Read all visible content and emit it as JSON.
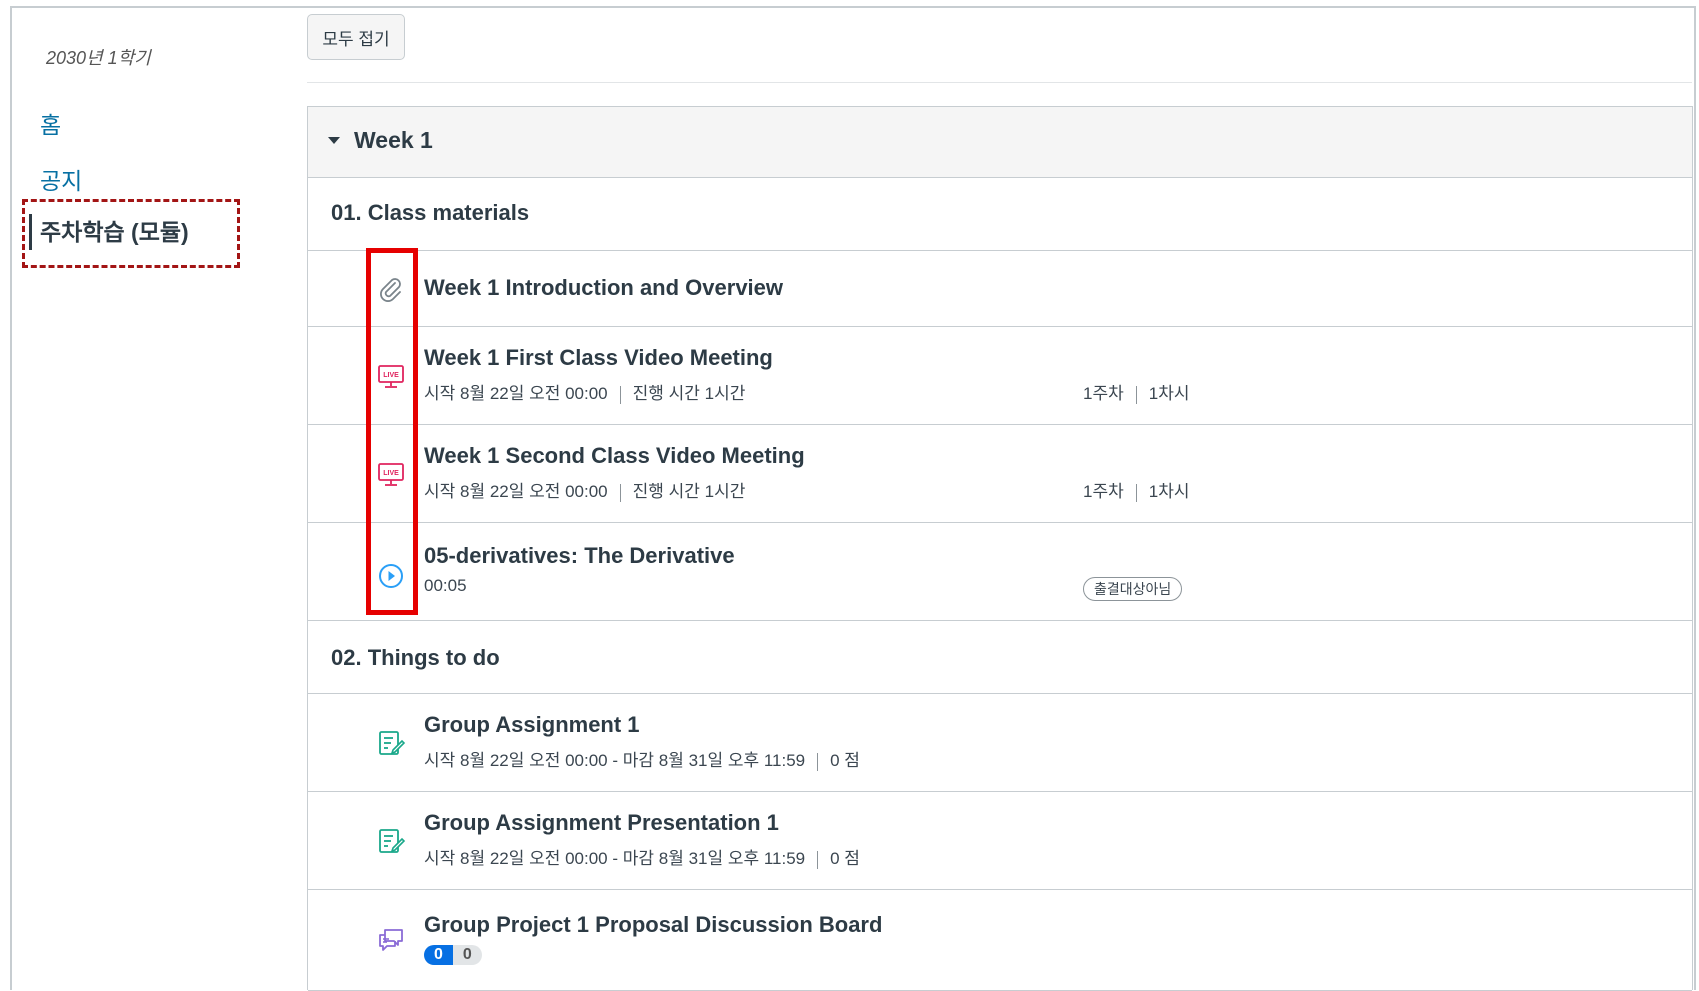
{
  "sidebar": {
    "term": "2030년 1학기",
    "nav": {
      "home": "홈",
      "notice": "공지",
      "modules": "주차학습 (모듈)"
    }
  },
  "toolbar": {
    "collapse_all": "모두 접기"
  },
  "module": {
    "title": "Week 1",
    "sections": [
      {
        "title": "01. Class materials",
        "items": [
          {
            "title": "Week 1 Introduction and Overview",
            "icon": "paperclip-icon"
          },
          {
            "title": "Week 1 First Class Video Meeting",
            "icon": "live-icon",
            "start": "시작  8월 22일 오전 00:00",
            "duration": "진행 시간 1시간",
            "week": "1주차",
            "session": "1차시"
          },
          {
            "title": "Week 1 Second Class Video Meeting",
            "icon": "live-icon",
            "start": "시작  8월 22일 오전 00:00",
            "duration": "진행 시간 1시간",
            "week": "1주차",
            "session": "1차시"
          },
          {
            "title": "05-derivatives: The Derivative",
            "icon": "play-icon",
            "time": "00:05",
            "badge": "출결대상아님"
          }
        ]
      },
      {
        "title": "02. Things to do",
        "items": [
          {
            "title": "Group Assignment 1",
            "icon": "assignment-icon",
            "range": "시작  8월 22일 오전 00:00  -  마감  8월 31일 오후 11:59",
            "points": "0 점"
          },
          {
            "title": "Group Assignment Presentation 1",
            "icon": "assignment-icon",
            "range": "시작  8월 22일 오전 00:00  -  마감  8월 31일 오후 11:59",
            "points": "0 점"
          },
          {
            "title": "Group Project 1 Proposal Discussion Board",
            "icon": "discussion-icon",
            "unread": "0",
            "total": "0"
          }
        ]
      }
    ]
  },
  "colors": {
    "link": "#0770a3",
    "live": "#e0245e",
    "play": "#2a9ff7",
    "assignment": "#1aa88a",
    "discussion": "#8a6bd6",
    "highlight": "#e60000"
  }
}
